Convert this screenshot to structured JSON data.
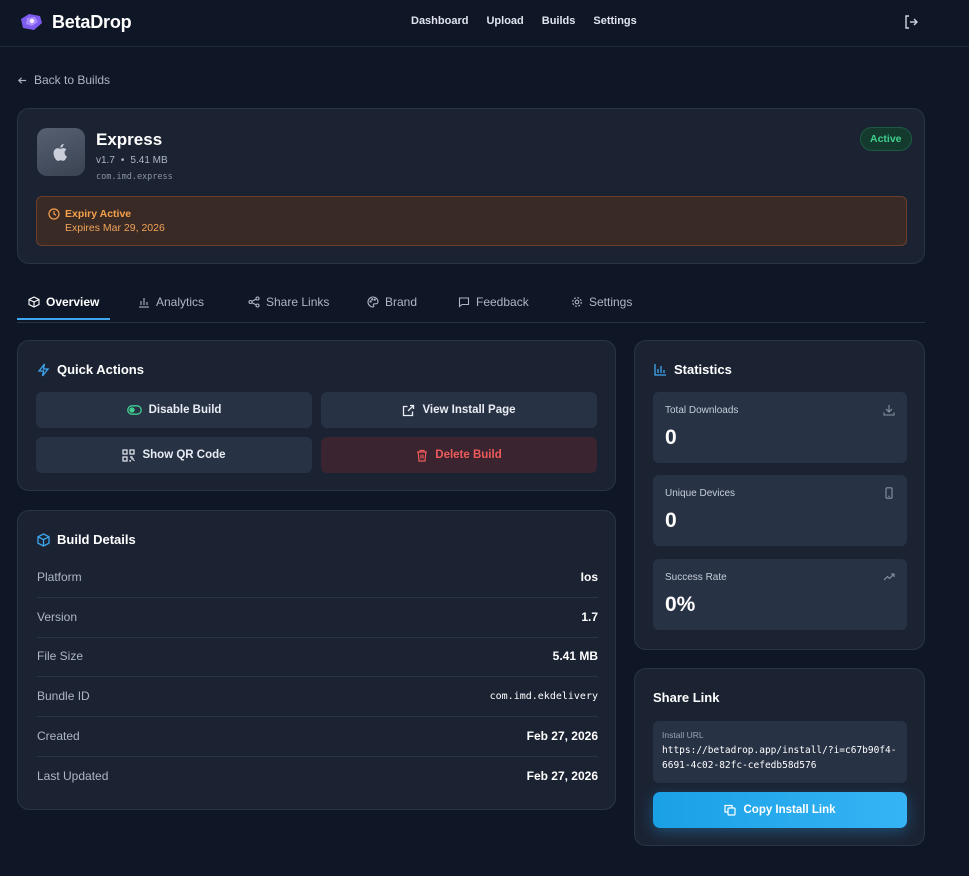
{
  "brand": {
    "name": "BetaDrop"
  },
  "nav": {
    "links": [
      "Dashboard",
      "Upload",
      "Builds",
      "Settings"
    ]
  },
  "back_label": "Back to Builds",
  "app": {
    "name": "Express",
    "version": "v1.7",
    "size": "5.41 MB",
    "bundle": "com.imd.express",
    "status": "Active"
  },
  "expiry": {
    "title": "Expiry Active",
    "subtitle": "Expires Mar 29, 2026"
  },
  "tabs": [
    "Overview",
    "Analytics",
    "Share Links",
    "Brand",
    "Feedback",
    "Settings"
  ],
  "quick_actions": {
    "title": "Quick Actions",
    "disable": "Disable Build",
    "view_install": "View Install Page",
    "qr": "Show QR Code",
    "delete": "Delete Build"
  },
  "build_details": {
    "title": "Build Details",
    "rows": [
      {
        "label": "Platform",
        "value": "Ios"
      },
      {
        "label": "Version",
        "value": "1.7"
      },
      {
        "label": "File Size",
        "value": "5.41 MB"
      },
      {
        "label": "Bundle ID",
        "value": "com.imd.ekdelivery"
      },
      {
        "label": "Created",
        "value": "Feb 27, 2026"
      },
      {
        "label": "Last Updated",
        "value": "Feb 27, 2026"
      }
    ]
  },
  "statistics": {
    "title": "Statistics",
    "items": [
      {
        "label": "Total Downloads",
        "value": "0",
        "icon": "download-icon"
      },
      {
        "label": "Unique Devices",
        "value": "0",
        "icon": "device-icon"
      },
      {
        "label": "Success Rate",
        "value": "0%",
        "icon": "trending-up-icon"
      }
    ]
  },
  "share": {
    "title": "Share Link",
    "url_label": "Install URL",
    "url": "https://betadrop.app/install/?i=c67b90f4-6691-4c02-82fc-cefedb58d576",
    "copy_label": "Copy Install Link"
  },
  "colors": {
    "background": "#0f1626",
    "card": "#1b2333",
    "accent": "#3ea7ee",
    "success": "#3fcf8e",
    "warning": "#f5a04a",
    "danger": "#ef5b5b"
  }
}
